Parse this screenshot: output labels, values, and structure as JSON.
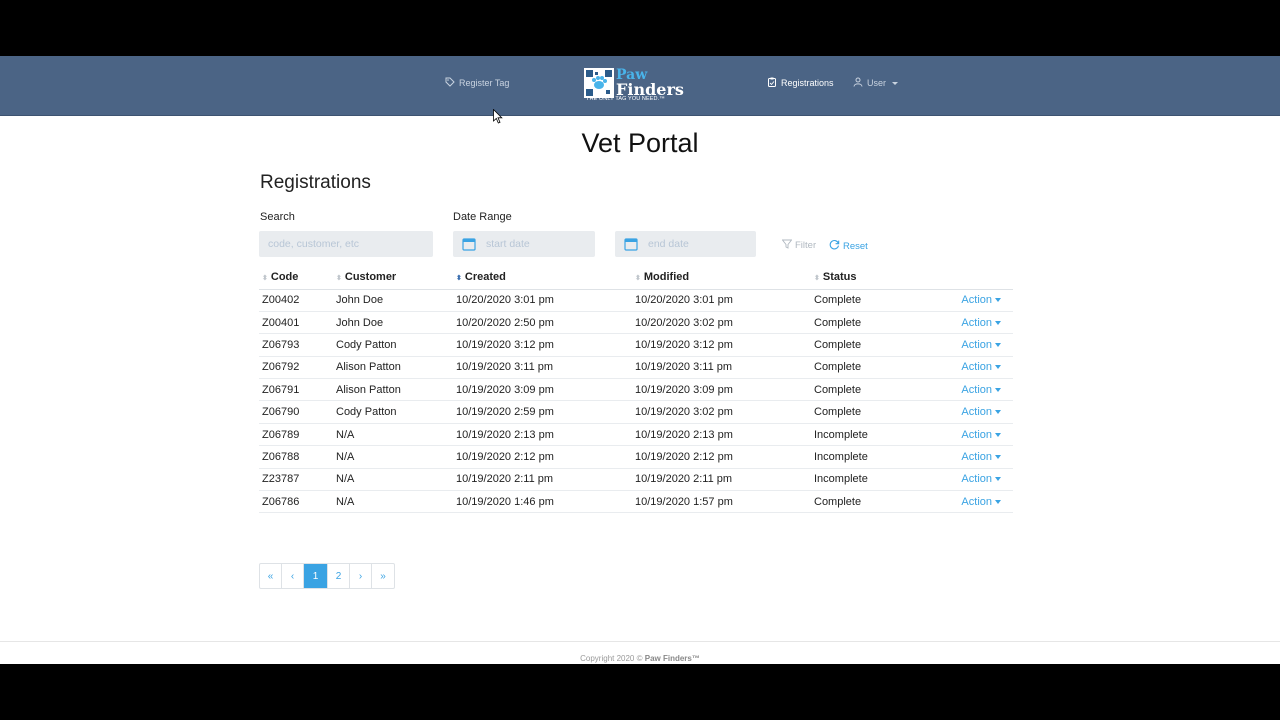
{
  "nav": {
    "register_tag": "Register Tag",
    "registrations": "Registrations",
    "user": "User"
  },
  "logo": {
    "word1": "Paw",
    "word2": "Finders",
    "tagline": "THE ONLY TAG YOU NEED.™"
  },
  "page_title": "Vet Portal",
  "section_title": "Registrations",
  "filters": {
    "search_label": "Search",
    "search_placeholder": "code, customer, etc",
    "date_range_label": "Date Range",
    "start_placeholder": "start date",
    "end_placeholder": "end date",
    "filter_label": "Filter",
    "reset_label": "Reset"
  },
  "table": {
    "headers": [
      "Code",
      "Customer",
      "Created",
      "Modified",
      "Status"
    ],
    "rows": [
      {
        "code": "Z00402",
        "customer": "John Doe",
        "created": "10/20/2020 3:01 pm",
        "modified": "10/20/2020 3:01 pm",
        "status": "Complete",
        "action": "Action"
      },
      {
        "code": "Z00401",
        "customer": "John Doe",
        "created": "10/20/2020 2:50 pm",
        "modified": "10/20/2020 3:02 pm",
        "status": "Complete",
        "action": "Action"
      },
      {
        "code": "Z06793",
        "customer": "Cody Patton",
        "created": "10/19/2020 3:12 pm",
        "modified": "10/19/2020 3:12 pm",
        "status": "Complete",
        "action": "Action"
      },
      {
        "code": "Z06792",
        "customer": "Alison Patton",
        "created": "10/19/2020 3:11 pm",
        "modified": "10/19/2020 3:11 pm",
        "status": "Complete",
        "action": "Action"
      },
      {
        "code": "Z06791",
        "customer": "Alison Patton",
        "created": "10/19/2020 3:09 pm",
        "modified": "10/19/2020 3:09 pm",
        "status": "Complete",
        "action": "Action"
      },
      {
        "code": "Z06790",
        "customer": "Cody Patton",
        "created": "10/19/2020 2:59 pm",
        "modified": "10/19/2020 3:02 pm",
        "status": "Complete",
        "action": "Action"
      },
      {
        "code": "Z06789",
        "customer": "N/A",
        "created": "10/19/2020 2:13 pm",
        "modified": "10/19/2020 2:13 pm",
        "status": "Incomplete",
        "action": "Action"
      },
      {
        "code": "Z06788",
        "customer": "N/A",
        "created": "10/19/2020 2:12 pm",
        "modified": "10/19/2020 2:12 pm",
        "status": "Incomplete",
        "action": "Action"
      },
      {
        "code": "Z23787",
        "customer": "N/A",
        "created": "10/19/2020 2:11 pm",
        "modified": "10/19/2020 2:11 pm",
        "status": "Incomplete",
        "action": "Action"
      },
      {
        "code": "Z06786",
        "customer": "N/A",
        "created": "10/19/2020 1:46 pm",
        "modified": "10/19/2020 1:57 pm",
        "status": "Complete",
        "action": "Action"
      }
    ]
  },
  "pagination": {
    "first": "«",
    "prev": "‹",
    "pages": [
      "1",
      "2"
    ],
    "current": "1",
    "next": "›",
    "last": "»"
  },
  "footer": {
    "text": "Copyright 2020 ©",
    "brand": "Paw Finders™"
  },
  "colors": {
    "navbar": "#4b6485",
    "accent": "#3aa3e3"
  },
  "icons": {
    "register_tag": "tag-icon",
    "registrations": "clipboard-icon",
    "user": "person-icon",
    "calendar": "calendar-icon",
    "filter": "funnel-icon",
    "reset": "refresh-icon"
  }
}
